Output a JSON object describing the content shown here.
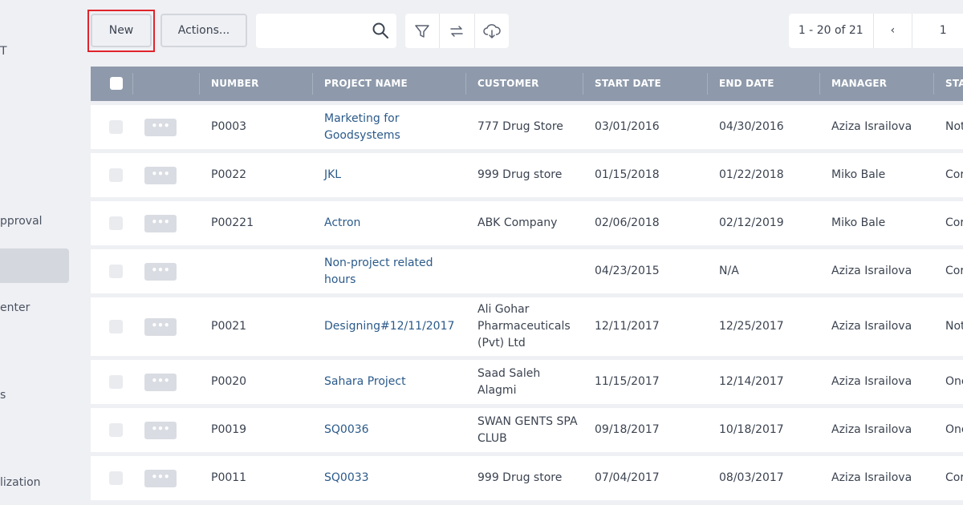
{
  "sidebar": {
    "items": [
      "T",
      "pproval",
      "enter",
      "s",
      "lization"
    ]
  },
  "toolbar": {
    "new_label": "New",
    "actions_label": "Actions...",
    "search_placeholder": "",
    "icons": [
      "filter-icon",
      "swap-icon",
      "cloud-download-icon"
    ]
  },
  "pager": {
    "range": "1 - 20 of 21",
    "prev": "‹",
    "page": "1"
  },
  "table": {
    "headers": [
      "NUMBER",
      "PROJECT NAME",
      "CUSTOMER",
      "START DATE",
      "END DATE",
      "MANAGER",
      "STA"
    ],
    "rows": [
      {
        "number": "P0003",
        "project": "Marketing for Goodsystems",
        "customer": "777 Drug Store",
        "start": "03/01/2016",
        "end": "04/30/2016",
        "manager": "Aziza Israilova",
        "status": "Not"
      },
      {
        "number": "P0022",
        "project": "JKL",
        "customer": "999 Drug store",
        "start": "01/15/2018",
        "end": "01/22/2018",
        "manager": "Miko Bale",
        "status": "Cor"
      },
      {
        "number": "P00221",
        "project": "Actron",
        "customer": "ABK Company",
        "start": "02/06/2018",
        "end": "02/12/2019",
        "manager": "Miko Bale",
        "status": "Cor"
      },
      {
        "number": "",
        "project": "Non-project related hours",
        "customer": "",
        "start": "04/23/2015",
        "end": "N/A",
        "manager": "Aziza Israilova",
        "status": "Cor"
      },
      {
        "number": "P0021",
        "project": "Designing#12/11/2017",
        "customer": "Ali Gohar Pharmaceuticals (Pvt) Ltd",
        "start": "12/11/2017",
        "end": "12/25/2017",
        "manager": "Aziza Israilova",
        "status": "Not"
      },
      {
        "number": "P0020",
        "project": "Sahara Project",
        "customer": "Saad Saleh Alagmi",
        "start": "11/15/2017",
        "end": "12/14/2017",
        "manager": "Aziza Israilova",
        "status": "One"
      },
      {
        "number": "P0019",
        "project": "SQ0036",
        "customer": "SWAN GENTS SPA CLUB",
        "start": "09/18/2017",
        "end": "10/18/2017",
        "manager": "Aziza Israilova",
        "status": "One"
      },
      {
        "number": "P0011",
        "project": "SQ0033",
        "customer": "999 Drug store",
        "start": "07/04/2017",
        "end": "08/03/2017",
        "manager": "Aziza Israilova",
        "status": "Cor"
      }
    ],
    "row_menu_label": "•••"
  },
  "colors": {
    "header_bg": "#8e9aab",
    "link": "#2b5a8a",
    "highlight": "#e0242b",
    "page_bg": "#eff0f4"
  }
}
